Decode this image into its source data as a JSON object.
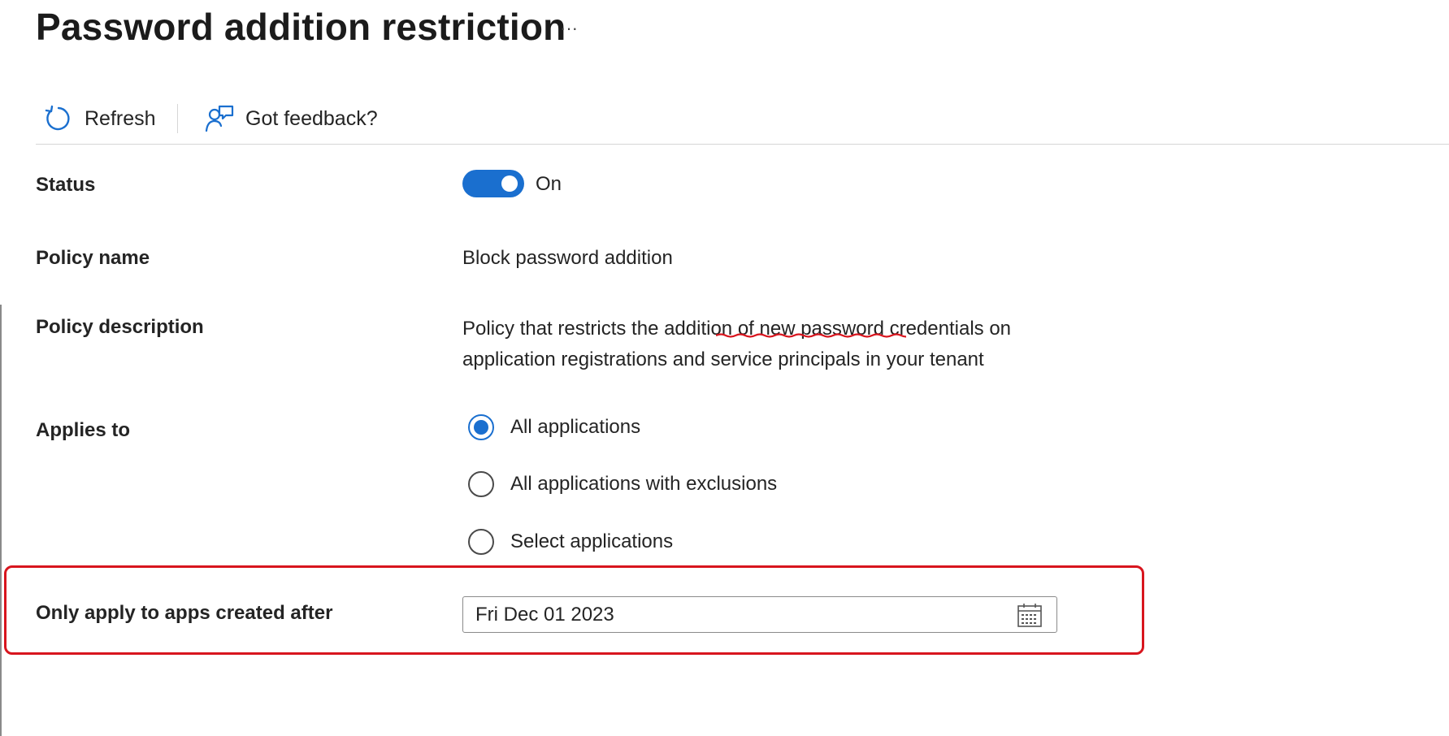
{
  "header": {
    "title": "Password addition restriction",
    "more_label": "···"
  },
  "toolbar": {
    "refresh_label": "Refresh",
    "refresh_icon": "refresh-icon",
    "feedback_label": "Got feedback?",
    "feedback_icon": "feedback-icon"
  },
  "form": {
    "status": {
      "label": "Status",
      "value": "On",
      "enabled": true
    },
    "policy_name": {
      "label": "Policy name",
      "value": "Block password addition"
    },
    "policy_description": {
      "label": "Policy description",
      "line1": "Policy that restricts the addition of new password credentials on",
      "line2": "application registrations and service principals in your tenant"
    },
    "applies_to": {
      "label": "Applies to",
      "options": [
        {
          "label": "All applications",
          "selected": true
        },
        {
          "label": "All applications with exclusions",
          "selected": false
        },
        {
          "label": "Select applications",
          "selected": false
        }
      ]
    },
    "created_after": {
      "label": "Only apply to apps created after",
      "value": "Fri Dec 01 2023",
      "icon": "calendar-icon"
    }
  },
  "colors": {
    "accent": "#1a6fcf",
    "highlight": "#d8151e",
    "text": "#242424"
  }
}
